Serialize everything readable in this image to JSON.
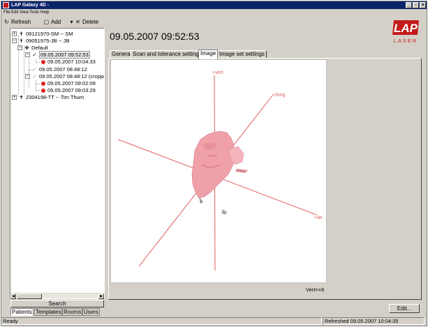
{
  "window": {
    "title": "LAP Galaxy 4D -",
    "controls": {
      "minimize": "_",
      "maximize": "▫",
      "close": "×"
    }
  },
  "menu": [
    "File",
    "Edit",
    "View",
    "Tools",
    "Help"
  ],
  "toolbar": {
    "refresh": "Refresh",
    "add": "Add",
    "delete": "Delete"
  },
  "tree": {
    "patient1": "08121970-SM -- SM",
    "patient2": "09051975-JB -- JB",
    "plan": "Default",
    "scan1": "09.05.2007 09:52:53",
    "scan1_child": "09.05.2007 10:04:33",
    "scan2": "09.05.2007 08:48:12",
    "scan3": "09.05.2007 08:48:12 (croppe",
    "scan3_child1": "09.05.2007 09:02:09",
    "scan3_child2": "09.05.2007 09:03:29",
    "patient3": "2304198-TT -- Tim Thum"
  },
  "search_label": "Search",
  "bottom_tabs": [
    "Patients",
    "Templates",
    "Rooms",
    "Users"
  ],
  "heading": "09.05.2007 09:52:53",
  "logo": {
    "mark": "LAP",
    "subtitle": "LASER",
    "color": "#c41a1a"
  },
  "tabs": [
    "General",
    "Scan and tolerance settings",
    "Image",
    "Image set settings"
  ],
  "active_tab": "Image",
  "viewer": {
    "axis_vert": "+vert",
    "axis_long": "+long",
    "axis_lat": "+lat",
    "axis_color": "#e06060",
    "surface_color": "#f0a0a8",
    "readout": "Vert=+6"
  },
  "edit_button": "Edit...",
  "status": {
    "left": "Ready",
    "right": "Refreshed 09.05.2007 10:04:35"
  }
}
